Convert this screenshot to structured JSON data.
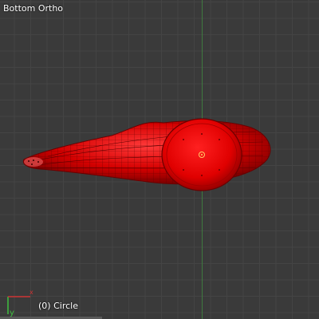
{
  "viewport": {
    "view_label": "Bottom Ortho",
    "object_label": "(0) Circle",
    "axis_label_y": "y",
    "axis_label_x": "x"
  },
  "mesh": {
    "icon": "mesh-object-icon",
    "color": "#e00000"
  }
}
